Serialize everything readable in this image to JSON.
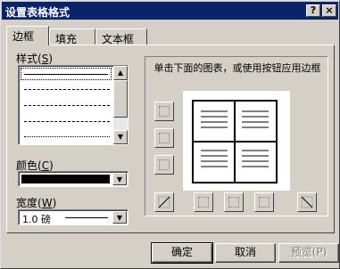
{
  "window": {
    "title": "设置表格格式",
    "help_label": "?",
    "close_label": "×"
  },
  "tabs": [
    {
      "label": "边框",
      "active": true
    },
    {
      "label": "填充",
      "active": false
    },
    {
      "label": "文本框",
      "active": false
    }
  ],
  "style": {
    "label": "样式(S)",
    "label_main": "样式",
    "hotkey": "S",
    "scroll_up": "▲",
    "scroll_down": "▼"
  },
  "color": {
    "label_main": "颜色",
    "hotkey": "C",
    "value_hex": "#000000",
    "arrow": "▼"
  },
  "width": {
    "label_main": "宽度",
    "hotkey": "W",
    "value": "1.0 磅",
    "arrow": "▼"
  },
  "preview": {
    "instruction": "单击下面的图表，或使用按钮应用边框"
  },
  "buttons": {
    "ok": "确定",
    "cancel": "取消",
    "preview": "预览(P)"
  }
}
